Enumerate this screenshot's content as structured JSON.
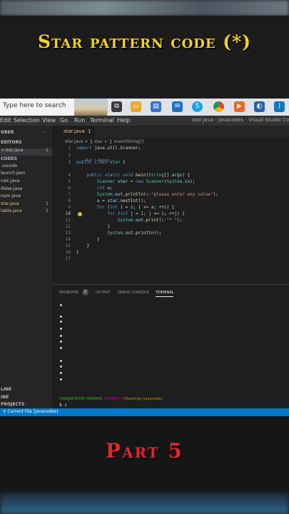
{
  "overlay": {
    "headline": "Star pattern code (*)",
    "part": "Part 5"
  },
  "taskbar": {
    "search_placeholder": "Type here to search",
    "icons": [
      "task-view-icon",
      "file-explorer-icon",
      "store-icon",
      "mail-icon",
      "skype-icon",
      "chrome-icon",
      "app-orange-icon",
      "vscode-icon"
    ]
  },
  "vscode": {
    "menu": [
      "Edit",
      "Selection",
      "View",
      "Go",
      "Run",
      "Terminal",
      "Help"
    ],
    "window_title": "star.java - javacodes - Visual Studio Co",
    "sidebar": {
      "header_top": "ORER",
      "open_editors": "EDITORS",
      "open_file": "star.java",
      "open_file_badge": "1",
      "folder": "CODES",
      "files": [
        ".vscode",
        "launch.json",
        "calc.java",
        "ifelse.java",
        "num.java",
        "star.java",
        "table.java"
      ],
      "star_badge": "1",
      "table_badge": "1",
      "bottom_sections": [
        "LINE",
        "INE",
        "PROJECTS"
      ]
    },
    "tab_label": "star.java",
    "tab_badge": "1",
    "breadcrumb": "star.java > ❙ star > ❙ main(String[])",
    "codelens": "Run | Debug",
    "line_numbers": [
      "1",
      "2",
      "3",
      "4",
      "5",
      "6",
      "7",
      "8",
      "9",
      "10",
      "11",
      "12",
      "13",
      "14",
      "15",
      "16",
      "17"
    ],
    "panel_tabs": [
      "PROBLEMS",
      "OUTPUT",
      "DEBUG CONSOLE",
      "TERMINAL"
    ],
    "problems_count": "2",
    "terminal_prompt_user": "YASH@DESKTOP-NOKK0OU",
    "terminal_prompt_env": "MINGW64",
    "terminal_prompt_path": "~/Desktop/javacodes",
    "terminal_input": "$ ▯",
    "status_text": "Current File (javacodes)",
    "accent_color": "#007acc"
  }
}
